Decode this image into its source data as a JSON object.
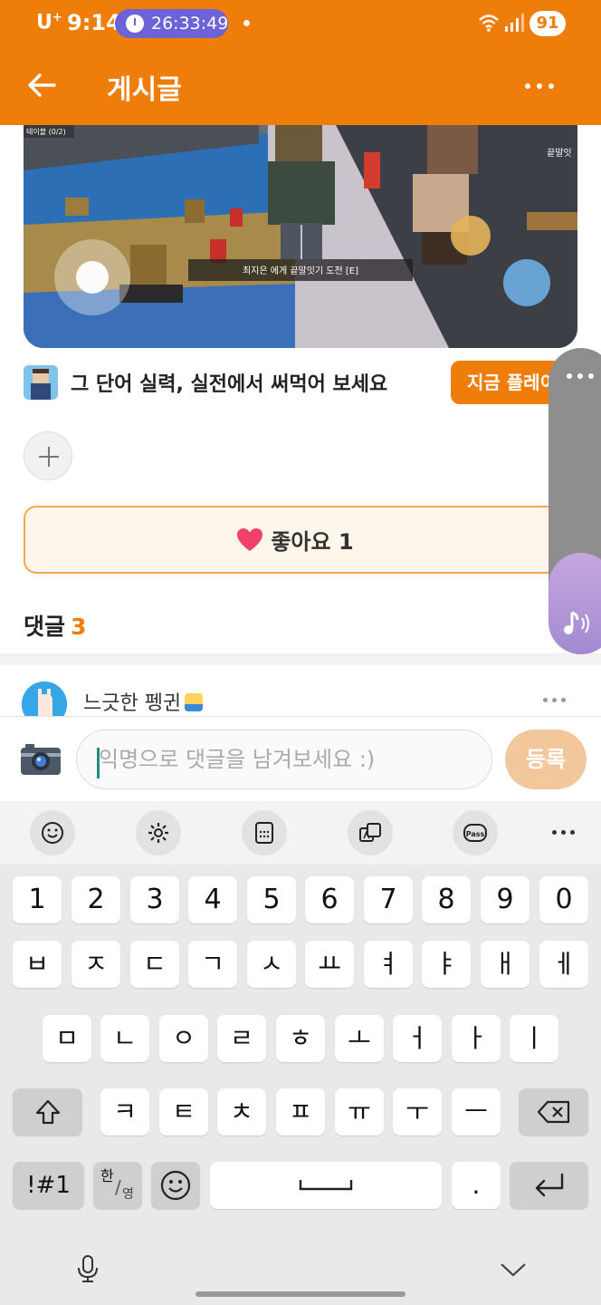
{
  "status_bar": {
    "carrier": "U",
    "carrier_sup": "+",
    "time": "9:14",
    "timer": "26:33:49",
    "battery": "91"
  },
  "app_bar": {
    "title": "게시글",
    "back_icon": "arrow-left-icon",
    "more_icon": "more-horizontal-icon"
  },
  "game_image": {
    "hud_left": "테이블 (0/2)",
    "hud_right": "끝말잇",
    "prompt": "최지은 에게 끝말잇기 도전 [E]"
  },
  "promo": {
    "text": "그 단어 실력, 실전에서 써먹어 보세요",
    "button_label": "지금 플레이"
  },
  "like": {
    "label": "좋아요 1"
  },
  "comments": {
    "heading": "댓글",
    "count": "3",
    "items": [
      {
        "author": "느긋한 펭귄"
      }
    ]
  },
  "comment_input": {
    "placeholder": "익명으로 댓글을 남겨보세요 :)",
    "submit_label": "등록"
  },
  "keyboard": {
    "number_row": [
      "1",
      "2",
      "3",
      "4",
      "5",
      "6",
      "7",
      "8",
      "9",
      "0"
    ],
    "row1": [
      "ㅂ",
      "ㅈ",
      "ㄷ",
      "ㄱ",
      "ㅅ",
      "ㅛ",
      "ㅕ",
      "ㅑ",
      "ㅐ",
      "ㅔ"
    ],
    "row2": [
      "ㅁ",
      "ㄴ",
      "ㅇ",
      "ㄹ",
      "ㅎ",
      "ㅗ",
      "ㅓ",
      "ㅏ",
      "ㅣ"
    ],
    "row3": [
      "ㅋ",
      "ㅌ",
      "ㅊ",
      "ㅍ",
      "ㅠ",
      "ㅜ",
      "ㅡ"
    ],
    "symbols_label": "!#1",
    "lang_top": "한",
    "lang_bottom": "영",
    "period_label": ".",
    "colors": {
      "accent": "#ee7d0a",
      "key": "#ffffff",
      "key_dark": "#cfcfcf",
      "background": "#e9e9e9"
    }
  }
}
